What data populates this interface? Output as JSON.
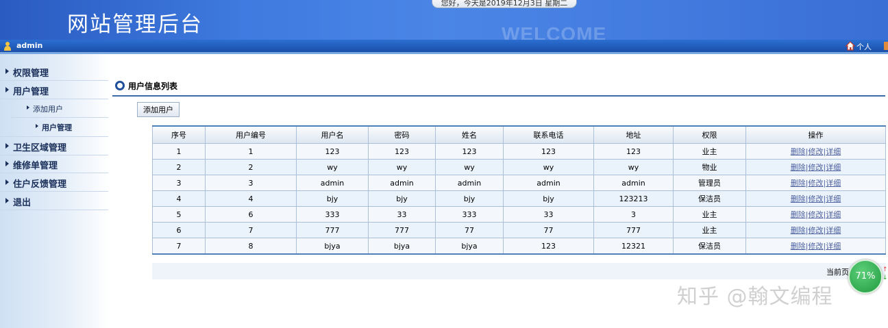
{
  "header": {
    "site_title": "网站管理后台",
    "welcome": "WELCOME",
    "date_greeting": "您好，今天是2019年12月3日 星期二"
  },
  "userbar": {
    "username": "admin",
    "personal": "个人"
  },
  "sidebar": {
    "items": [
      {
        "label": "权限管理"
      },
      {
        "label": "用户管理"
      },
      {
        "label": "添加用户"
      },
      {
        "label": "用户管理"
      },
      {
        "label": "卫生区域管理"
      },
      {
        "label": "维修单管理"
      },
      {
        "label": "住户反馈管理"
      },
      {
        "label": "退出"
      }
    ]
  },
  "main": {
    "section_title": "用户信息列表",
    "add_button": "添加用户",
    "table": {
      "headers": [
        "序号",
        "用户编号",
        "用户名",
        "密码",
        "姓名",
        "联系电话",
        "地址",
        "权限",
        "操作"
      ],
      "rows": [
        [
          "1",
          "1",
          "123",
          "123",
          "123",
          "123",
          "123",
          "业主"
        ],
        [
          "2",
          "2",
          "wy",
          "wy",
          "wy",
          "wy",
          "wy",
          "物业"
        ],
        [
          "3",
          "3",
          "admin",
          "admin",
          "admin",
          "admin",
          "admin",
          "管理员"
        ],
        [
          "4",
          "4",
          "bjy",
          "bjy",
          "bjy",
          "bjy",
          "123213",
          "保洁员"
        ],
        [
          "5",
          "6",
          "333",
          "33",
          "333",
          "33",
          "3",
          "业主"
        ],
        [
          "6",
          "7",
          "777",
          "777",
          "77",
          "77",
          "777",
          "业主"
        ],
        [
          "7",
          "8",
          "bjya",
          "bjya",
          "bjya",
          "123",
          "12321",
          "保洁员"
        ]
      ],
      "ops": {
        "delete": "删除",
        "edit": "修改",
        "detail": "详细",
        "sep": "|"
      }
    },
    "pagination_text": "当前页"
  },
  "overlay": {
    "progress": "71%",
    "watermark": "知乎 @翰文编程"
  }
}
